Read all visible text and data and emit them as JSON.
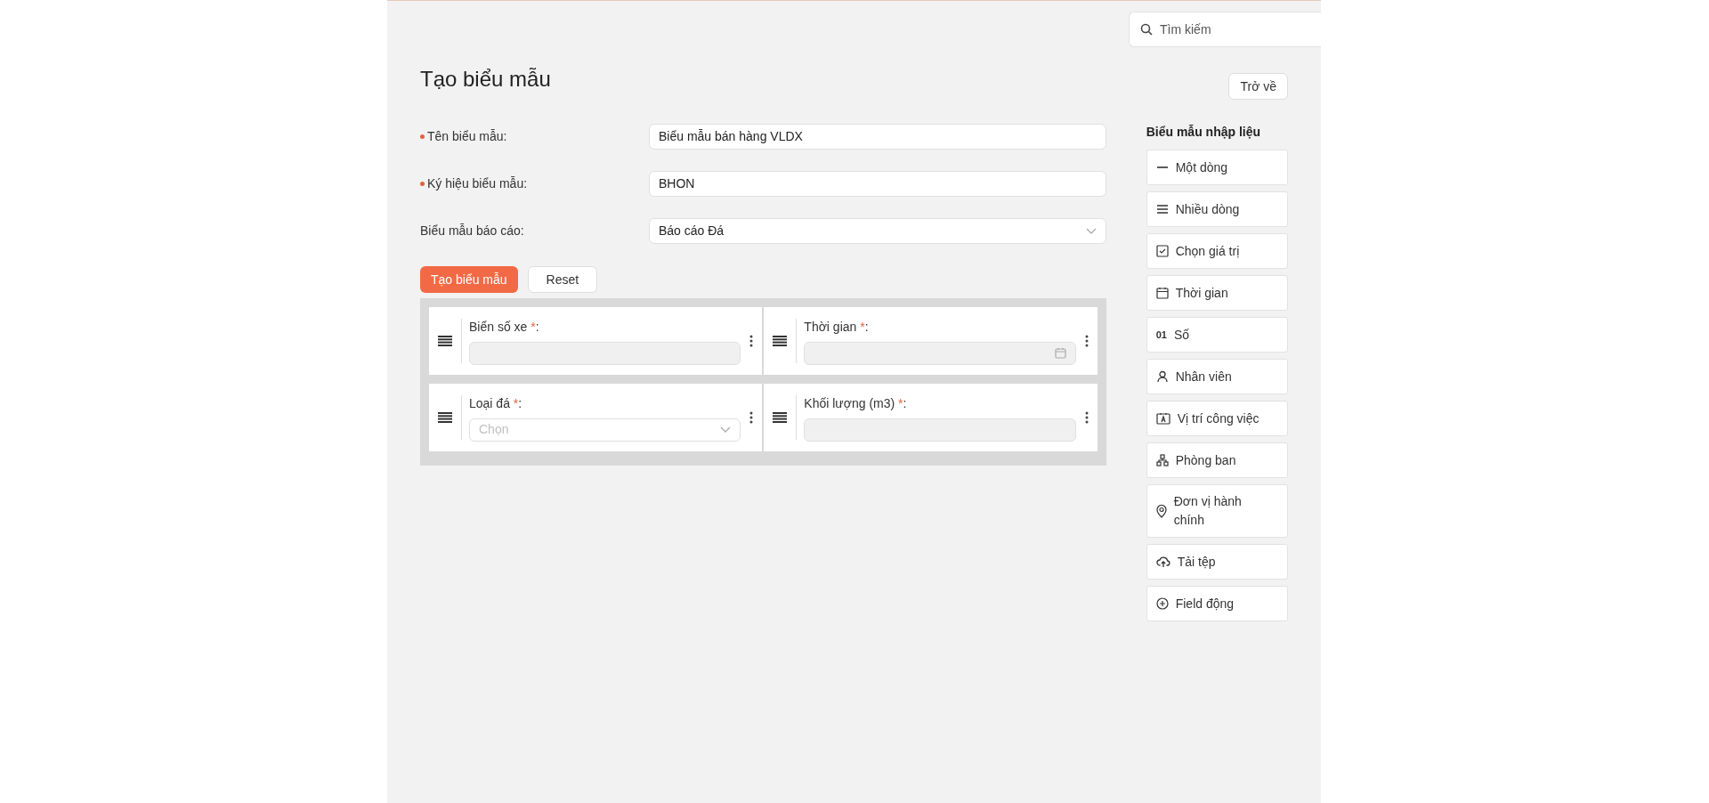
{
  "search": {
    "placeholder": "Tìm kiếm"
  },
  "page": {
    "title": "Tạo biểu mẫu",
    "back_button": "Trở về"
  },
  "form": {
    "rows": [
      {
        "label": "Tên biểu mẫu:",
        "required": true,
        "kind": "text",
        "value": "Biểu mẫu bán hàng VLDX"
      },
      {
        "label": "Ký hiệu biểu mẫu:",
        "required": true,
        "kind": "text",
        "value": "BHON"
      },
      {
        "label": "Biểu mẫu báo cáo:",
        "required": false,
        "kind": "select",
        "value": "Báo cáo Đá"
      }
    ],
    "buttons": [
      {
        "label": "Tạo biểu mẫu",
        "kind": "primary"
      },
      {
        "label": "Reset",
        "kind": "secondary"
      }
    ]
  },
  "canvas": {
    "fields": [
      {
        "label": "Biển số xe",
        "required_mark": "*",
        "suffix": ":",
        "kind": "text"
      },
      {
        "label": "Thời gian",
        "required_mark": "*",
        "suffix": ":",
        "kind": "date"
      },
      {
        "label": "Loại đá",
        "required_mark": "*",
        "suffix": ":",
        "kind": "select",
        "placeholder": "Chọn"
      },
      {
        "label": "Khối lượng (m3)",
        "required_mark": "*",
        "suffix": ":",
        "kind": "text"
      }
    ]
  },
  "palette": {
    "title": "Biểu mẫu nhập liệu",
    "items": [
      {
        "label": "Một dòng",
        "kind": "line"
      },
      {
        "label": "Nhiều dòng",
        "kind": "lines"
      },
      {
        "label": "Chọn giá trị",
        "kind": "check"
      },
      {
        "label": "Thời gian",
        "kind": "calendar"
      },
      {
        "label": "Số",
        "kind": "number",
        "icon_text": "01"
      },
      {
        "label": "Nhân viên",
        "kind": "person"
      },
      {
        "label": "Vị trí công việc",
        "kind": "badge"
      },
      {
        "label": "Phòng ban",
        "kind": "org"
      },
      {
        "label": "Đơn vị hành chính",
        "kind": "pin"
      },
      {
        "label": "Tải tệp",
        "kind": "upload"
      },
      {
        "label": "Field động",
        "kind": "plus"
      }
    ]
  }
}
